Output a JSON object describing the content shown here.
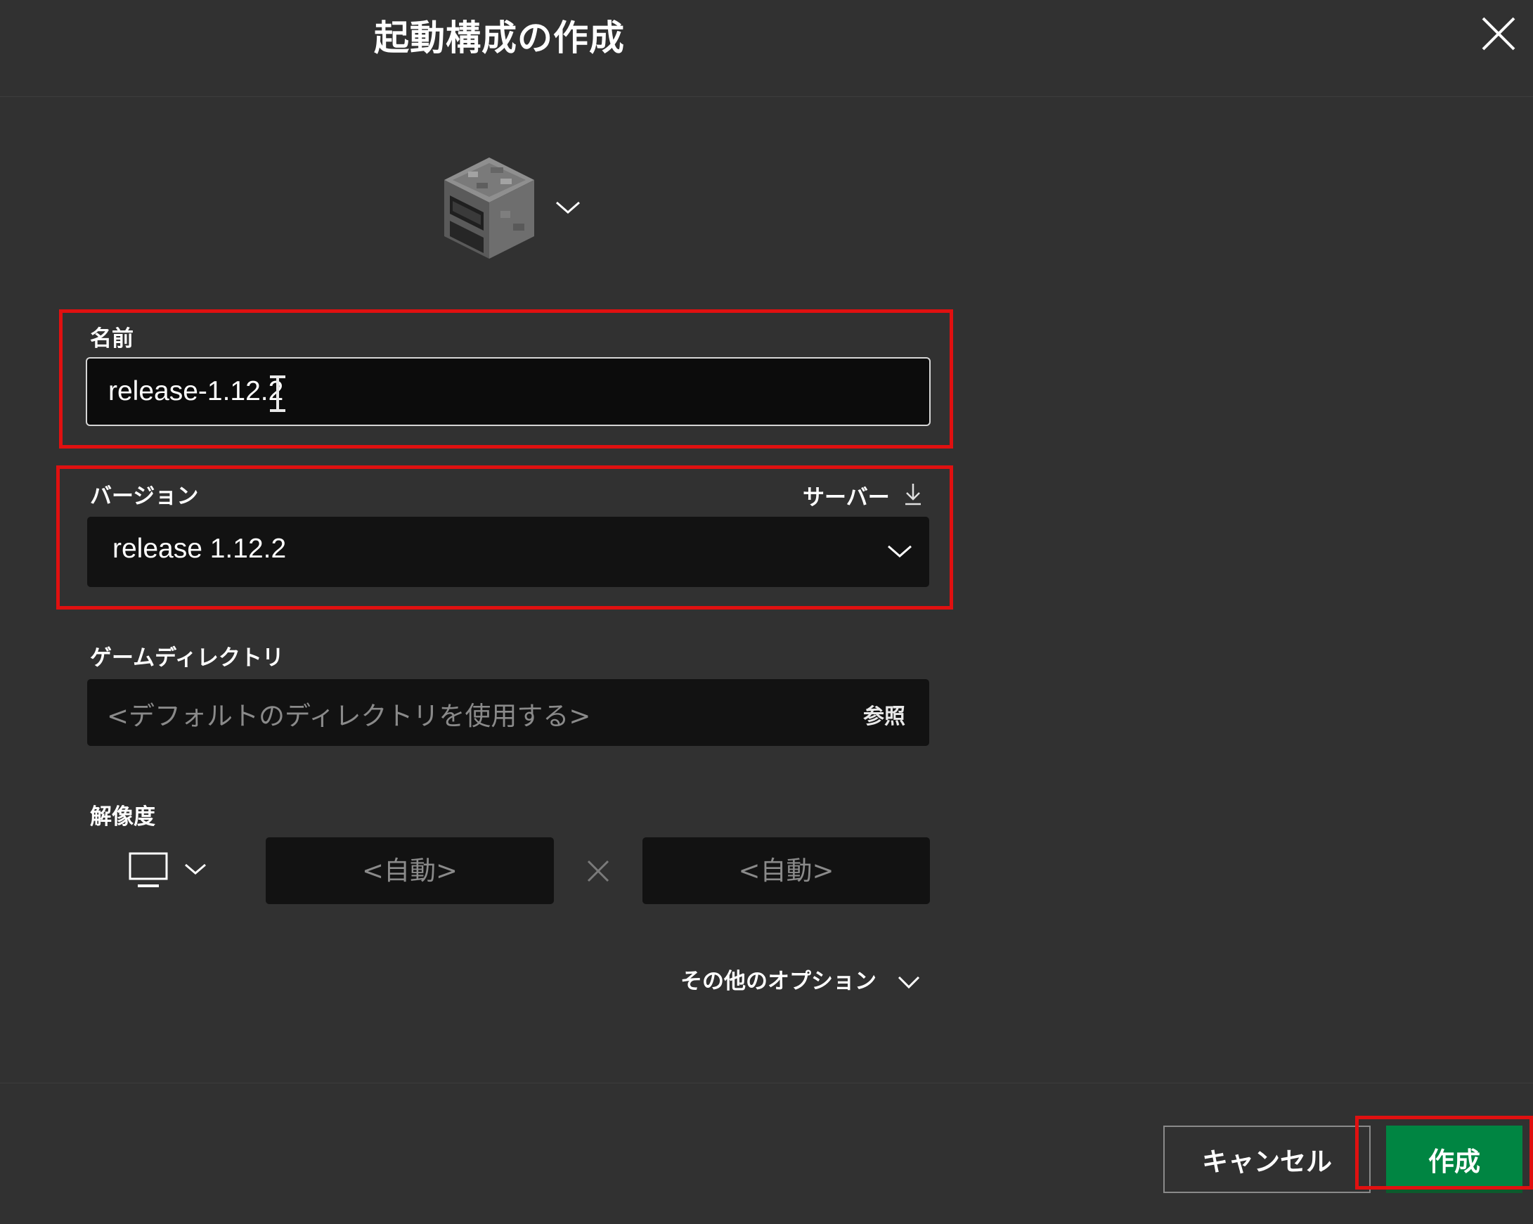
{
  "dialog": {
    "title": "起動構成の作成",
    "close_icon": "close-icon"
  },
  "profile": {
    "icon": "furnace-block-icon",
    "dropdown_icon": "chevron-down-icon"
  },
  "name": {
    "label": "名前",
    "value": "release-1.12.2"
  },
  "version": {
    "label": "バージョン",
    "server_link": "サーバー",
    "server_icon": "download-icon",
    "selected": "release 1.12.2"
  },
  "game_directory": {
    "label": "ゲームディレクトリ",
    "placeholder": "<デフォルトのディレクトリを使用する>",
    "browse": "参照"
  },
  "resolution": {
    "label": "解像度",
    "monitor_icon": "monitor-icon",
    "width_placeholder": "<自動>",
    "height_placeholder": "<自動>"
  },
  "more_options": {
    "label": "その他のオプション"
  },
  "footer": {
    "cancel": "キャンセル",
    "create": "作成"
  },
  "colors": {
    "background": "#313131",
    "field": "#121212",
    "primary": "#008542",
    "highlight": "#e01010"
  }
}
